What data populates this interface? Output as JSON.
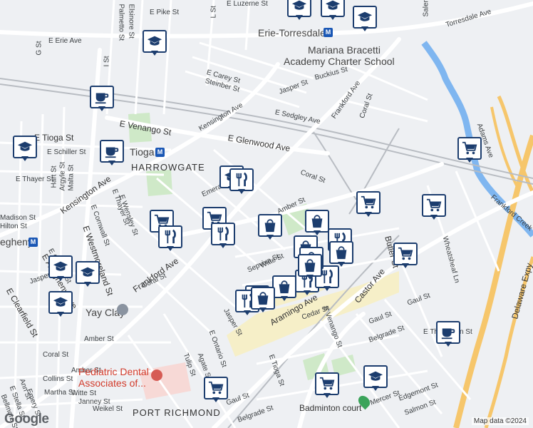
{
  "map": {
    "streets": [
      "E Erie Ave",
      "E Pike St",
      "Palmetto St",
      "Elsinore St",
      "L St",
      "G St",
      "I St",
      "E Luzerne St",
      "Torresdale Ave",
      "Salem St",
      "E Carey St",
      "Steinber St",
      "Kensington Ave",
      "Jasper St",
      "Buckius St",
      "Frankford Ave",
      "E Sedgley Ave",
      "Coral St",
      "E Venango St",
      "E Glenwood Ave",
      "E Tioga St",
      "E Schiller St",
      "E Thayer St",
      "Hart St",
      "Argyle St",
      "Malta St",
      "Adams Ave",
      "Coral St",
      "Emerald St",
      "Kensington Ave",
      "E Thayer St",
      "E Wensley St",
      "E Cornwall St",
      "E Westmoreland St",
      "Madison St",
      "Hilton St",
      "E Ontario St",
      "Jasper St",
      "E Clearfield St",
      "Frankford Ave",
      "Coral St",
      "Sepviva St",
      "Witte St",
      "Amber St",
      "Aramingo Ave",
      "Castor Ave",
      "Butler St",
      "Wheatsheaf Ln",
      "Delaware Expy",
      "Frankford Creek",
      "Cedar St",
      "E Venango St",
      "Gaul St",
      "Belgrade St",
      "E Thompson St",
      "E Tioga St",
      "E Ontario St",
      "Tulip St",
      "Agate St",
      "Amber St",
      "Coral St",
      "Collins St",
      "Martha St",
      "Amber St",
      "Witte St",
      "Janney St",
      "Weikel St",
      "Ann St",
      "E Stella St",
      "Emery St",
      "Bellmore St",
      "Salmon St",
      "Edgemont St",
      "Mercer St",
      "Belgrade St",
      "Gaul St",
      "E Allegheny Ave",
      "Jasper St",
      "Gaul St"
    ],
    "labels": {
      "station_erie": "Erie-Torresdale",
      "school": [
        "Mariana Bracetti",
        "Academy Charter School"
      ],
      "station_tioga": "Tioga",
      "neighborhood_1": "HARROWGATE",
      "neighborhood_2": "PORT RICHMOND",
      "station_allegheny": "egheny",
      "poi_clay": "Yay Clay",
      "poi_dental": [
        "Pediatric Dental",
        "Associates of..."
      ],
      "poi_court": "Badminton court"
    },
    "metro_letter": "M",
    "attribution": "Map data ©2024",
    "logo": "Google",
    "markers": [
      {
        "type": "school"
      },
      {
        "type": "school"
      },
      {
        "type": "school"
      },
      {
        "type": "school"
      },
      {
        "type": "school"
      },
      {
        "type": "school"
      },
      {
        "type": "school"
      },
      {
        "type": "school"
      },
      {
        "type": "school"
      },
      {
        "type": "school"
      },
      {
        "type": "cafe"
      },
      {
        "type": "cafe"
      },
      {
        "type": "cafe"
      },
      {
        "type": "shopping-cart"
      },
      {
        "type": "shopping-cart"
      },
      {
        "type": "shopping-cart"
      },
      {
        "type": "shopping-cart"
      },
      {
        "type": "shopping-cart"
      },
      {
        "type": "shopping-cart"
      },
      {
        "type": "shopping-cart"
      },
      {
        "type": "shopping-cart"
      },
      {
        "type": "restaurant"
      },
      {
        "type": "restaurant"
      },
      {
        "type": "restaurant"
      },
      {
        "type": "restaurant"
      },
      {
        "type": "restaurant"
      },
      {
        "type": "restaurant"
      },
      {
        "type": "restaurant"
      },
      {
        "type": "restaurant"
      },
      {
        "type": "shopping-bag"
      },
      {
        "type": "shopping-bag"
      },
      {
        "type": "shopping-bag"
      },
      {
        "type": "shopping-bag"
      },
      {
        "type": "shopping-bag"
      },
      {
        "type": "shopping-bag"
      },
      {
        "type": "shopping-bag"
      },
      {
        "type": "shopping-bag"
      }
    ],
    "colors": {
      "marker_border": "#1c3d6e",
      "water": "#7fb6f0",
      "park": "#cfe9c8",
      "commercial": "#f6efc8",
      "medical": "#f7d9d6",
      "highway": "#f6c66b",
      "road": "#ffffff",
      "metro": "#1a57b5"
    }
  }
}
